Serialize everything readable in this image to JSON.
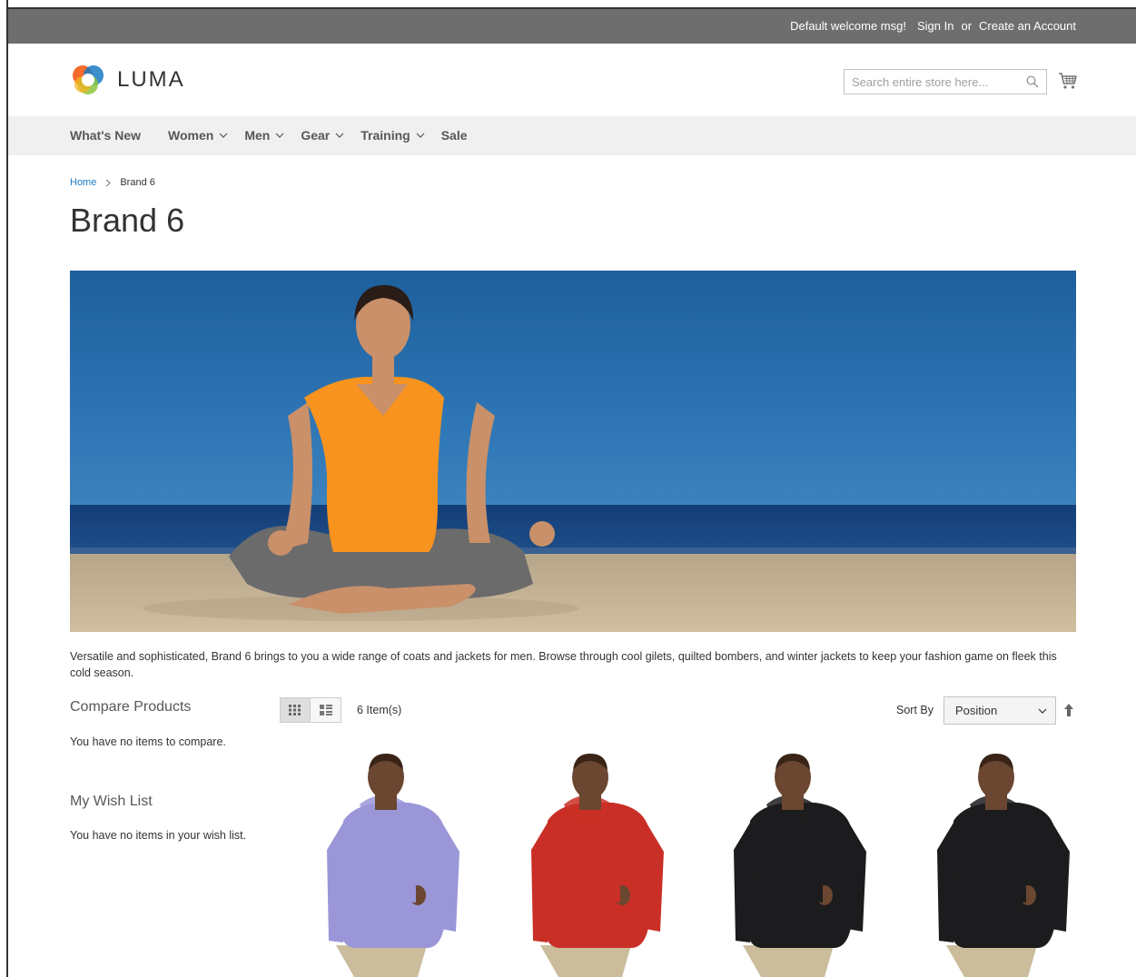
{
  "topbar": {
    "welcome": "Default welcome msg!",
    "sign_in": "Sign In",
    "or": "or",
    "create_account": "Create an Account"
  },
  "header": {
    "logo_text": "LUMA",
    "search_placeholder": "Search entire store here..."
  },
  "nav": {
    "items": [
      {
        "label": "What's New",
        "has_dropdown": false
      },
      {
        "label": "Women",
        "has_dropdown": true
      },
      {
        "label": "Men",
        "has_dropdown": true
      },
      {
        "label": "Gear",
        "has_dropdown": true
      },
      {
        "label": "Training",
        "has_dropdown": true
      },
      {
        "label": "Sale",
        "has_dropdown": false
      }
    ]
  },
  "breadcrumb": {
    "home": "Home",
    "current": "Brand 6"
  },
  "page": {
    "title": "Brand 6",
    "description": "Versatile and sophisticated, Brand 6 brings to you a wide range of coats and jackets for men. Browse through cool gilets, quilted bombers, and winter jackets to keep your fashion game on fleek this cold season."
  },
  "sidebar": {
    "compare_title": "Compare Products",
    "compare_empty": "You have no items to compare.",
    "wishlist_title": "My Wish List",
    "wishlist_empty": "You have no items in your wish list."
  },
  "toolbar": {
    "item_count": "6 Item(s)",
    "sort_label": "Sort By",
    "sort_value": "Position"
  },
  "products": [
    {
      "hoodie_color": "#9a96d8"
    },
    {
      "hoodie_color": "#c92f26"
    },
    {
      "hoodie_color": "#1c1c1e"
    },
    {
      "hoodie_color": "#1c1c1e"
    }
  ],
  "colors": {
    "topbar_bg": "#6e6e6e",
    "nav_bg": "#f0f0f0",
    "link": "#1979c3"
  }
}
